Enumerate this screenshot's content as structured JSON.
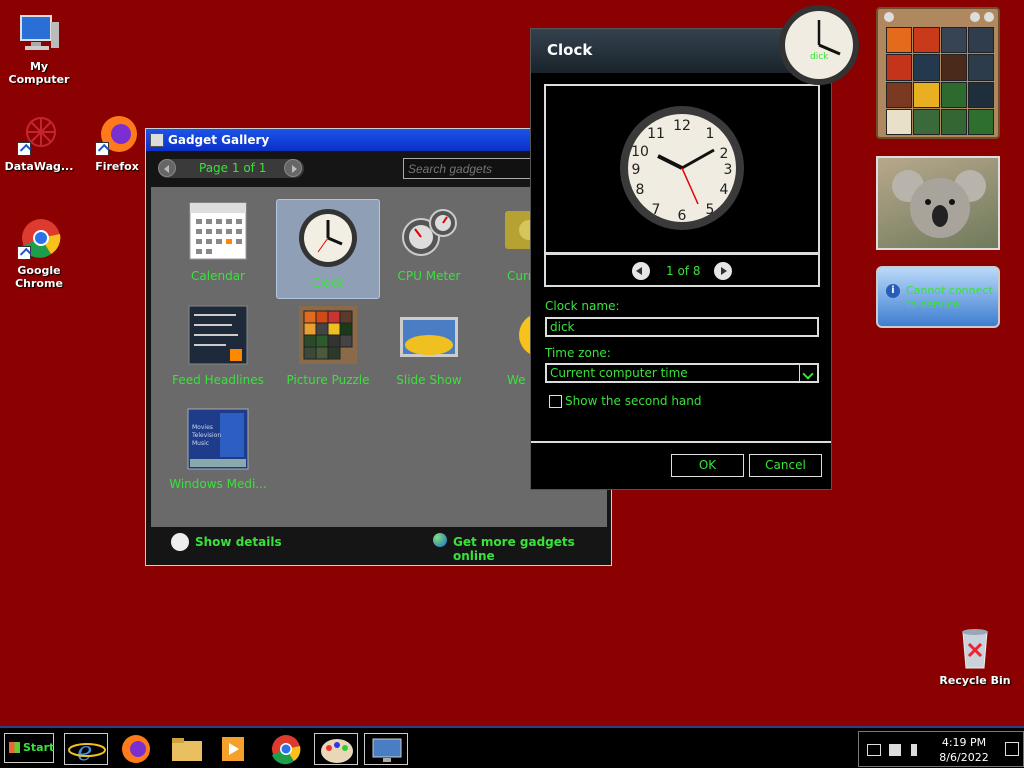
{
  "desktop": {
    "icons": [
      {
        "label": "My Computer",
        "icon": "computer-icon"
      },
      {
        "label": "DataWag...",
        "icon": "datawag-icon"
      },
      {
        "label": "Firefox",
        "icon": "firefox-icon"
      },
      {
        "label": "Google Chrome",
        "icon": "chrome-icon"
      },
      {
        "label": "Recycle Bin",
        "icon": "recycle-bin-icon"
      }
    ]
  },
  "gallery": {
    "title": "Gadget Gallery",
    "page_label": "Page 1 of 1",
    "search_placeholder": "Search gadgets",
    "items": [
      {
        "label": "Calendar"
      },
      {
        "label": "Clock"
      },
      {
        "label": "CPU Meter"
      },
      {
        "label": "Curr"
      },
      {
        "label": "Feed Headlines"
      },
      {
        "label": "Picture Puzzle"
      },
      {
        "label": "Slide Show"
      },
      {
        "label": "We"
      },
      {
        "label": "Windows Medi..."
      }
    ],
    "show_details": "Show details",
    "get_more": "Get more gadgets online"
  },
  "clock_dialog": {
    "title": "Clock",
    "pager": "1 of 8",
    "name_label": "Clock name:",
    "name_value": "dick",
    "tz_label": "Time zone:",
    "tz_value": "Current computer time",
    "second_hand_label": "Show the second hand",
    "ok": "OK",
    "cancel": "Cancel"
  },
  "sidebar": {
    "clock_label": "dick",
    "feed_message": "Cannot connect to service"
  },
  "taskbar": {
    "start": "Start",
    "time": "4:19 PM",
    "date": "8/6/2022"
  },
  "colors": {
    "desktop": "#8b0000",
    "accent_green": "#39e23a"
  }
}
